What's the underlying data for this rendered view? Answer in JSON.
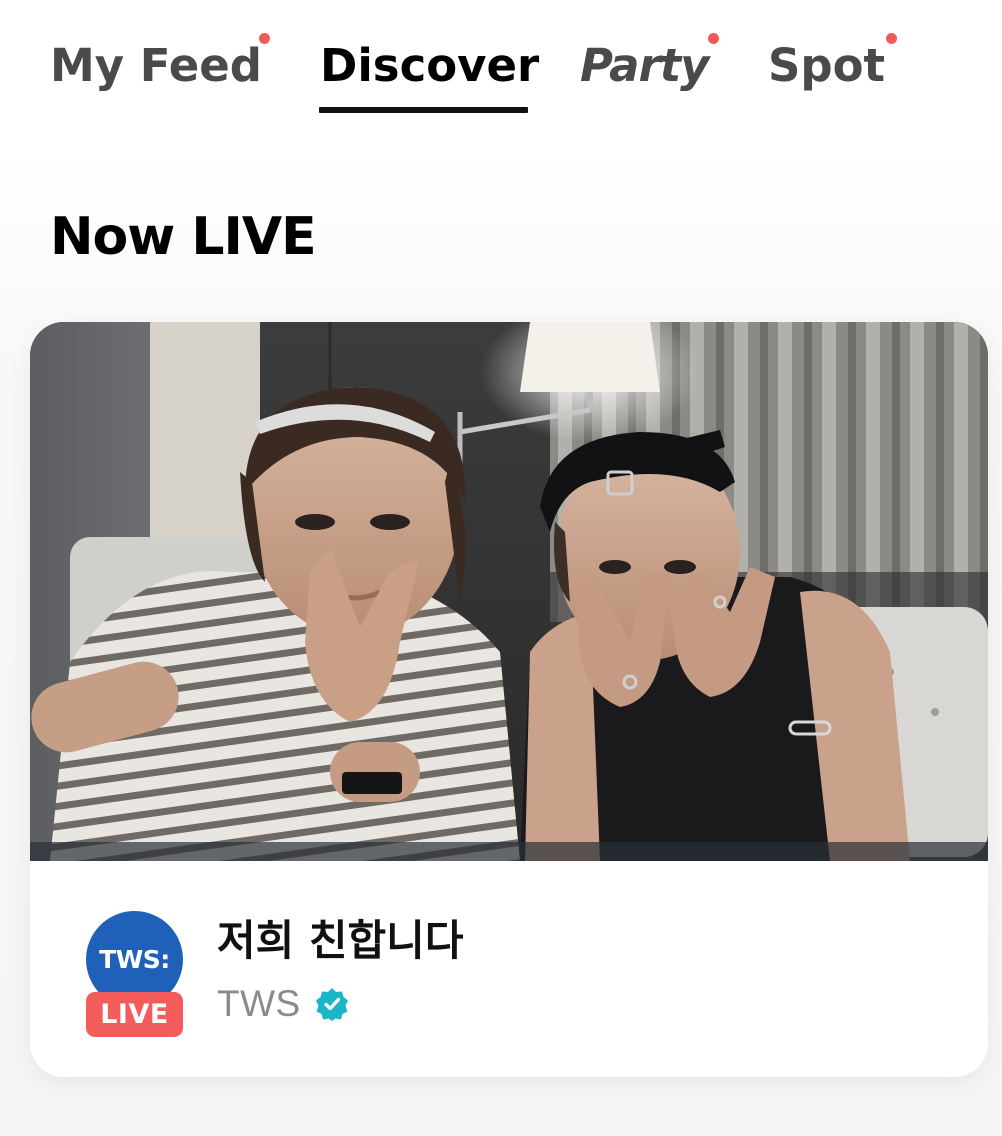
{
  "tabs": [
    {
      "label": "My Feed",
      "has_dot": true,
      "active": false
    },
    {
      "label": "Discover",
      "has_dot": false,
      "active": true
    },
    {
      "label": "Party",
      "has_dot": true,
      "active": false
    },
    {
      "label": "Spot",
      "has_dot": true,
      "active": false
    }
  ],
  "section": {
    "title": "Now LIVE"
  },
  "live_card": {
    "title": "저희 친합니다",
    "channel": "TWS",
    "avatar_text": "TWS:",
    "live_badge": "LIVE",
    "verified": true,
    "thumbnail": "photo-two-people-posing-peace-signs"
  },
  "colors": {
    "notification_dot": "#f2595b",
    "live_badge": "#f25c5a",
    "avatar_bg": "#1f61b8",
    "verified": "#1bb5c8"
  }
}
